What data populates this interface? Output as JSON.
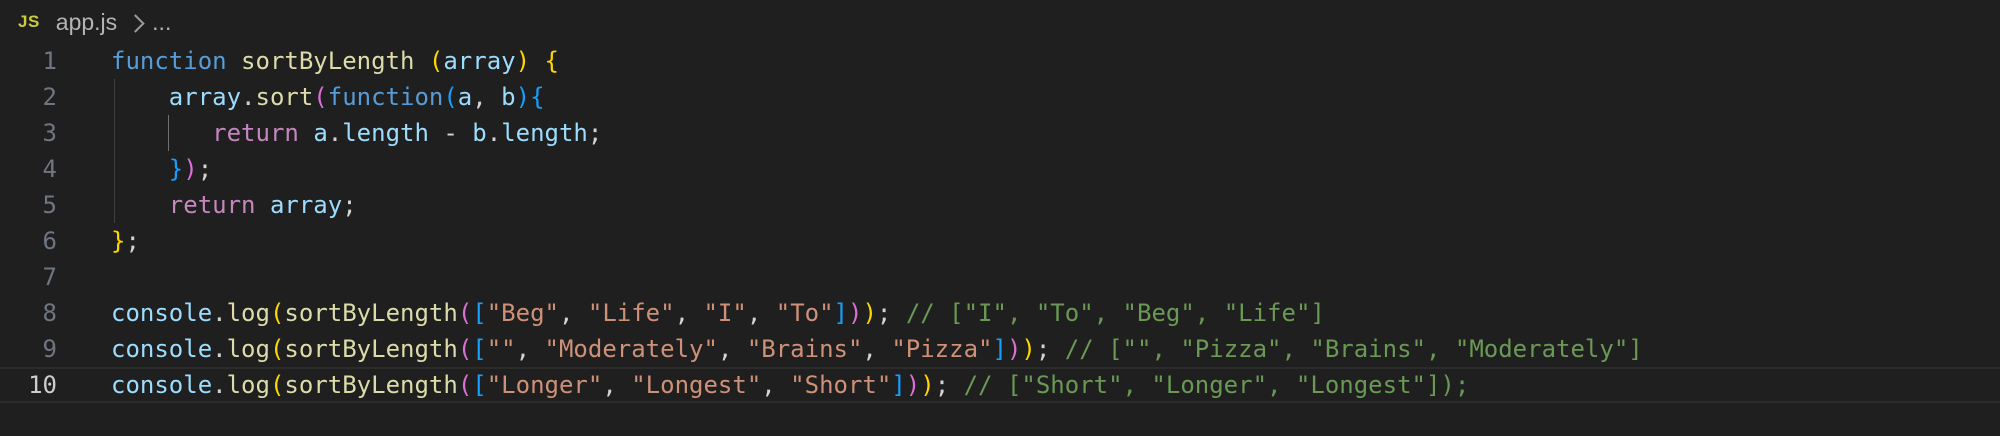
{
  "breadcrumb": {
    "language_badge": "JS",
    "file_name": "app.js",
    "ellipsis": "..."
  },
  "editor": {
    "active_line": 10,
    "lines": [
      {
        "number": "1",
        "tokens": [
          {
            "t": "function",
            "c": "kw"
          },
          {
            "t": " ",
            "c": "p"
          },
          {
            "t": "sortByLength",
            "c": "fn"
          },
          {
            "t": " ",
            "c": "p"
          },
          {
            "t": "(",
            "c": "b1"
          },
          {
            "t": "array",
            "c": "var"
          },
          {
            "t": ")",
            "c": "b1"
          },
          {
            "t": " ",
            "c": "p"
          },
          {
            "t": "{",
            "c": "b1"
          }
        ]
      },
      {
        "number": "2",
        "tokens": [
          {
            "t": "    ",
            "c": "p"
          },
          {
            "t": "array",
            "c": "var"
          },
          {
            "t": ".",
            "c": "p"
          },
          {
            "t": "sort",
            "c": "fn"
          },
          {
            "t": "(",
            "c": "b2"
          },
          {
            "t": "function",
            "c": "kw"
          },
          {
            "t": "(",
            "c": "b3"
          },
          {
            "t": "a",
            "c": "var"
          },
          {
            "t": ", ",
            "c": "p"
          },
          {
            "t": "b",
            "c": "var"
          },
          {
            "t": ")",
            "c": "b3"
          },
          {
            "t": "{",
            "c": "b3"
          }
        ]
      },
      {
        "number": "3",
        "tokens": [
          {
            "t": "       ",
            "c": "p"
          },
          {
            "t": "return",
            "c": "kwc"
          },
          {
            "t": " ",
            "c": "p"
          },
          {
            "t": "a",
            "c": "var"
          },
          {
            "t": ".",
            "c": "p"
          },
          {
            "t": "length",
            "c": "var"
          },
          {
            "t": " - ",
            "c": "p"
          },
          {
            "t": "b",
            "c": "var"
          },
          {
            "t": ".",
            "c": "p"
          },
          {
            "t": "length",
            "c": "var"
          },
          {
            "t": ";",
            "c": "p"
          }
        ]
      },
      {
        "number": "4",
        "tokens": [
          {
            "t": "    ",
            "c": "p"
          },
          {
            "t": "}",
            "c": "b3"
          },
          {
            "t": ")",
            "c": "b2"
          },
          {
            "t": ";",
            "c": "p"
          }
        ]
      },
      {
        "number": "5",
        "tokens": [
          {
            "t": "    ",
            "c": "p"
          },
          {
            "t": "return",
            "c": "kwc"
          },
          {
            "t": " ",
            "c": "p"
          },
          {
            "t": "array",
            "c": "var"
          },
          {
            "t": ";",
            "c": "p"
          }
        ]
      },
      {
        "number": "6",
        "tokens": [
          {
            "t": "}",
            "c": "b1"
          },
          {
            "t": ";",
            "c": "p"
          }
        ]
      },
      {
        "number": "7",
        "tokens": []
      },
      {
        "number": "8",
        "tokens": [
          {
            "t": "console",
            "c": "var"
          },
          {
            "t": ".",
            "c": "p"
          },
          {
            "t": "log",
            "c": "fn"
          },
          {
            "t": "(",
            "c": "b1"
          },
          {
            "t": "sortByLength",
            "c": "fn"
          },
          {
            "t": "(",
            "c": "b2"
          },
          {
            "t": "[",
            "c": "b3"
          },
          {
            "t": "\"Beg\"",
            "c": "str"
          },
          {
            "t": ", ",
            "c": "p"
          },
          {
            "t": "\"Life\"",
            "c": "str"
          },
          {
            "t": ", ",
            "c": "p"
          },
          {
            "t": "\"I\"",
            "c": "str"
          },
          {
            "t": ", ",
            "c": "p"
          },
          {
            "t": "\"To\"",
            "c": "str"
          },
          {
            "t": "]",
            "c": "b3"
          },
          {
            "t": ")",
            "c": "b2"
          },
          {
            "t": ")",
            "c": "b1"
          },
          {
            "t": "; ",
            "c": "p"
          },
          {
            "t": "// [\"I\", \"To\", \"Beg\", \"Life\"]",
            "c": "cm"
          }
        ]
      },
      {
        "number": "9",
        "tokens": [
          {
            "t": "console",
            "c": "var"
          },
          {
            "t": ".",
            "c": "p"
          },
          {
            "t": "log",
            "c": "fn"
          },
          {
            "t": "(",
            "c": "b1"
          },
          {
            "t": "sortByLength",
            "c": "fn"
          },
          {
            "t": "(",
            "c": "b2"
          },
          {
            "t": "[",
            "c": "b3"
          },
          {
            "t": "\"\"",
            "c": "str"
          },
          {
            "t": ", ",
            "c": "p"
          },
          {
            "t": "\"Moderately\"",
            "c": "str"
          },
          {
            "t": ", ",
            "c": "p"
          },
          {
            "t": "\"Brains\"",
            "c": "str"
          },
          {
            "t": ", ",
            "c": "p"
          },
          {
            "t": "\"Pizza\"",
            "c": "str"
          },
          {
            "t": "]",
            "c": "b3"
          },
          {
            "t": ")",
            "c": "b2"
          },
          {
            "t": ")",
            "c": "b1"
          },
          {
            "t": "; ",
            "c": "p"
          },
          {
            "t": "// [\"\", \"Pizza\", \"Brains\", \"Moderately\"]",
            "c": "cm"
          }
        ]
      },
      {
        "number": "10",
        "tokens": [
          {
            "t": "console",
            "c": "var"
          },
          {
            "t": ".",
            "c": "p"
          },
          {
            "t": "log",
            "c": "fn"
          },
          {
            "t": "(",
            "c": "b1"
          },
          {
            "t": "sortByLength",
            "c": "fn"
          },
          {
            "t": "(",
            "c": "b2"
          },
          {
            "t": "[",
            "c": "b3"
          },
          {
            "t": "\"Longer\"",
            "c": "str"
          },
          {
            "t": ", ",
            "c": "p"
          },
          {
            "t": "\"Longest\"",
            "c": "str"
          },
          {
            "t": ", ",
            "c": "p"
          },
          {
            "t": "\"Short\"",
            "c": "str"
          },
          {
            "t": "]",
            "c": "b3"
          },
          {
            "t": ")",
            "c": "b2"
          },
          {
            "t": ")",
            "c": "b1"
          },
          {
            "t": "; ",
            "c": "p"
          },
          {
            "t": "// [\"Short\", \"Longer\", \"Longest\"]);",
            "c": "cm"
          }
        ]
      }
    ]
  }
}
